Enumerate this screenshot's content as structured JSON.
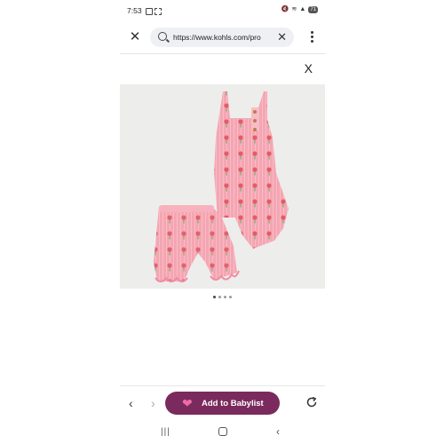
{
  "status_bar": {
    "time": "7:53",
    "battery": "71"
  },
  "browser": {
    "url": "https://www.kohls.com/pro",
    "close_symbol": "✕",
    "clear_symbol": "✕"
  },
  "product_view": {
    "close_symbol": "X",
    "image_alt": "Pink floral ribbed tank bodysuit and ruffle-trim shorts set",
    "dots_total": 4,
    "active_dot": 1
  },
  "toolbar": {
    "back_symbol": "‹",
    "forward_symbol": "›",
    "babylist_label": "Add to Babylist"
  },
  "system_nav": {
    "recent_symbol": "|||",
    "back_symbol": "‹"
  },
  "colors": {
    "babylist_button": "#7b2a5d",
    "garment_pink": "#f4a6b2",
    "image_background": "#ededec"
  }
}
